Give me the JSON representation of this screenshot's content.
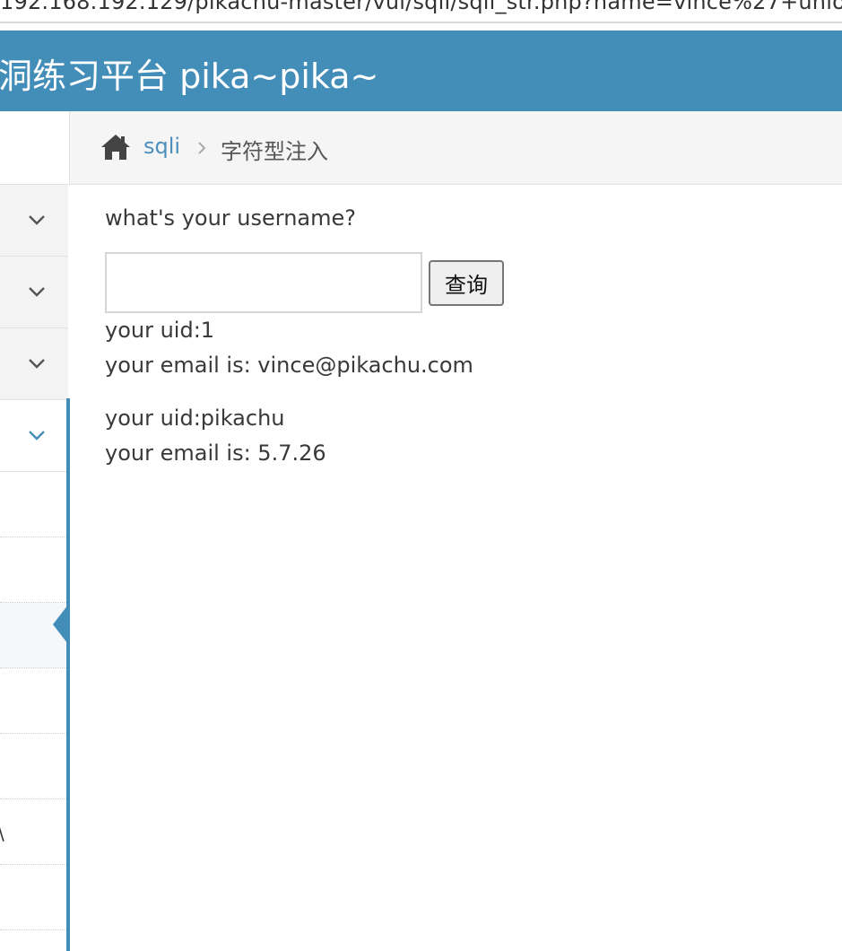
{
  "browser": {
    "url": "192.168.192.129/pikachu-master/vul/sqli/sqli_str.php?name=vince%27+unio"
  },
  "navbar": {
    "brand": "洞练习平台 pika~pika~"
  },
  "sidebar": {
    "menu_chevron_icons": [
      "chevron-down-icon",
      "chevron-down-icon",
      "chevron-down-icon",
      "chevron-down-icon"
    ],
    "partial_glyph": "\\",
    "active_color": "#438eb9"
  },
  "breadcrumbs": {
    "home_icon": "home-icon",
    "link": "sqli",
    "separator_icon": "chevron-right-icon",
    "current": "字符型注入"
  },
  "form": {
    "question": "what's your username?",
    "input_value": "",
    "submit_label": "查询"
  },
  "results": [
    {
      "uid_line": "your uid:1",
      "email_line": "your email is: vince@pikachu.com"
    },
    {
      "uid_line": "your uid:pikachu",
      "email_line": "your email is: 5.7.26"
    }
  ],
  "colors": {
    "navbar": "#438eb9",
    "link": "#4c8fbd",
    "text": "#393939"
  }
}
